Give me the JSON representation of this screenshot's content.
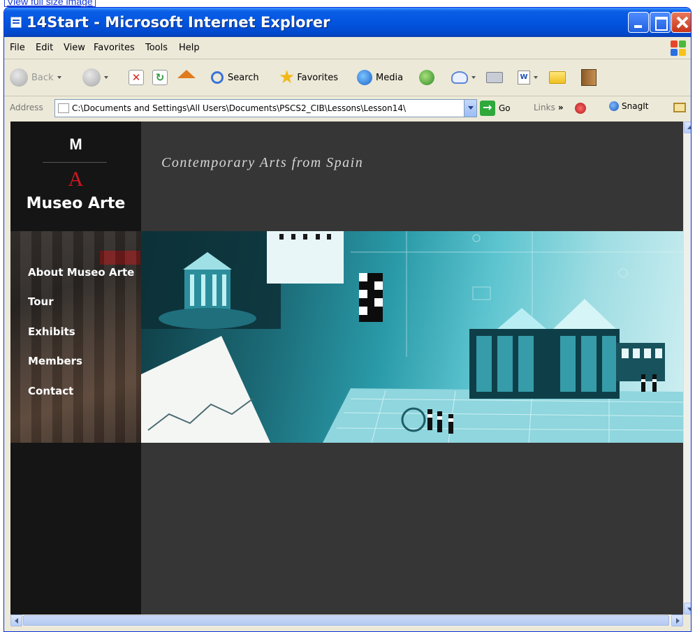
{
  "top_link": {
    "label": "View full size image"
  },
  "window": {
    "title": "14Start - Microsoft Internet Explorer"
  },
  "menu": {
    "items": [
      {
        "label": "File"
      },
      {
        "label": "Edit"
      },
      {
        "label": "View"
      },
      {
        "label": "Favorites"
      },
      {
        "label": "Tools"
      },
      {
        "label": "Help"
      }
    ]
  },
  "toolbar": {
    "back_label": "Back",
    "search_label": "Search",
    "favorites_label": "Favorites",
    "media_label": "Media"
  },
  "address": {
    "label": "Address",
    "value": "C:\\Documents and Settings\\All Users\\Documents\\PSCS2_CIB\\Lessons\\Lesson14\\",
    "go_label": "Go",
    "links_label": "Links",
    "snagit_label": "SnagIt"
  },
  "site": {
    "logo_m": "M",
    "logo_a": "A",
    "logo_name": "Museo Arte",
    "tagline": "Contemporary Arts from Spain",
    "nav": [
      {
        "label": "About Museo Arte"
      },
      {
        "label": "Tour"
      },
      {
        "label": "Exhibits"
      },
      {
        "label": "Members"
      },
      {
        "label": "Contact"
      }
    ]
  },
  "colors": {
    "titlebar": "#0254e0",
    "page_bg": "#363636",
    "sidebar_bg": "#151515",
    "logo_accent": "#d0181f",
    "hero_teal": "#2a9aa8"
  }
}
